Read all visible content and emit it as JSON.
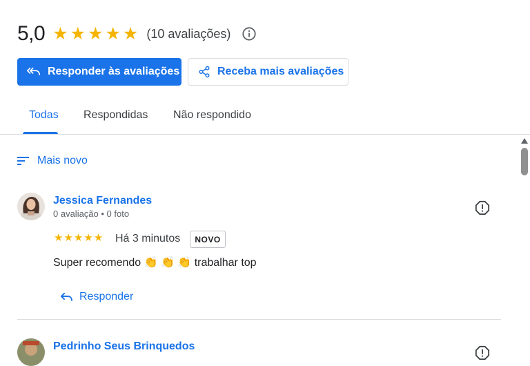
{
  "summary": {
    "score": "5,0",
    "stars": 5,
    "review_count": "(10 avaliações)"
  },
  "actions": {
    "reply_reviews": "Responder às avaliações",
    "get_more_reviews": "Receba mais avaliações"
  },
  "tabs": [
    {
      "label": "Todas",
      "active": true
    },
    {
      "label": "Respondidas",
      "active": false
    },
    {
      "label": "Não respondido",
      "active": false
    }
  ],
  "sort": {
    "label": "Mais novo"
  },
  "reviews": [
    {
      "name": "Jessica Fernandes",
      "meta": "0 avaliação • 0 foto",
      "rating": 5,
      "time": "Há 3 minutos",
      "badge": "NOVO",
      "text": "Super recomendo 👏 👏 👏 trabalhar top",
      "reply_label": "Responder"
    },
    {
      "name": "Pedrinho Seus Brinquedos"
    }
  ],
  "colors": {
    "accent": "#1a73e8",
    "star": "#f4b400",
    "divider": "#dadce0"
  }
}
